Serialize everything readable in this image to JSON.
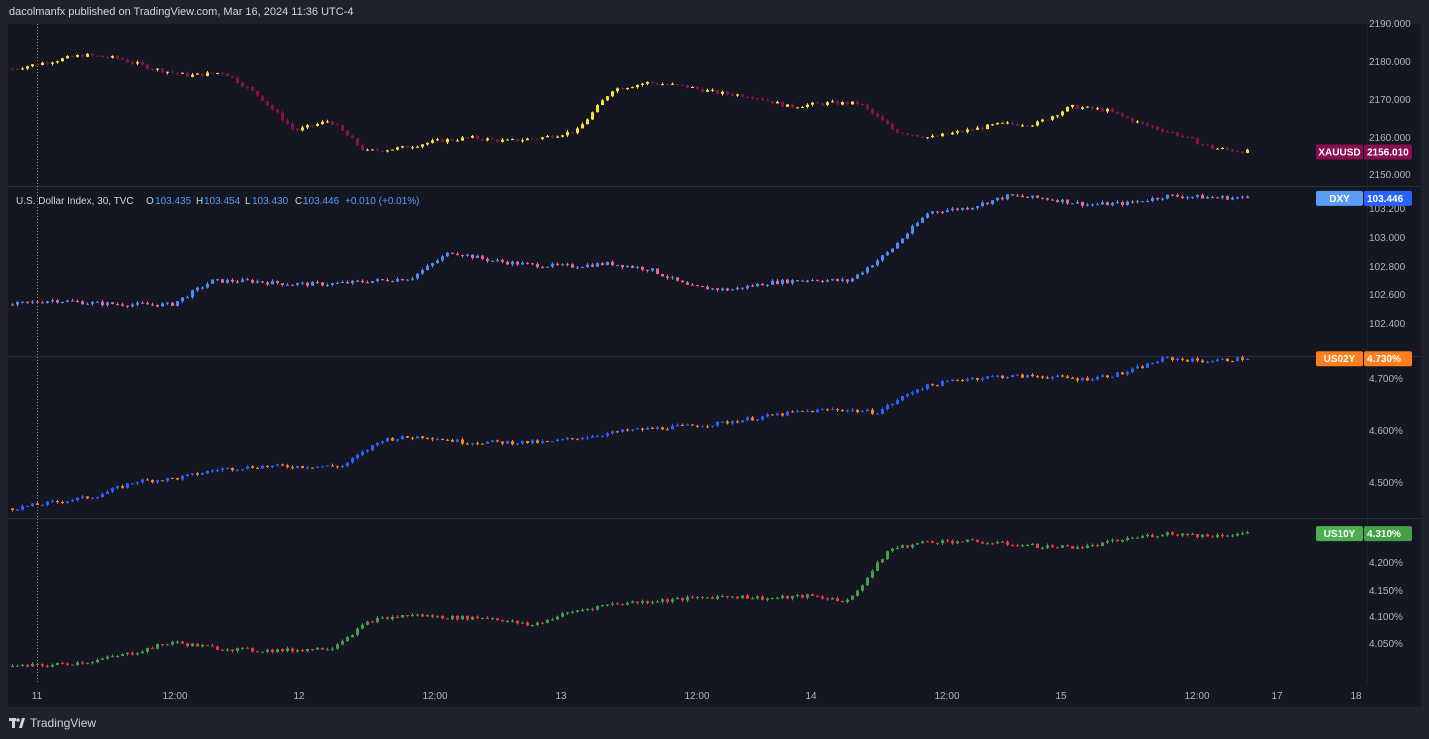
{
  "header": {
    "publisher_line": "dacolmanfx published on TradingView.com, Mar 16, 2024 11:36 UTC-4"
  },
  "footer": {
    "brand": "TradingView"
  },
  "legend": {
    "dxy": {
      "name": "U.S. Dollar Index, 30, TVC",
      "o_label": "O",
      "o_value": "103.435",
      "h_label": "H",
      "h_value": "103.454",
      "l_label": "L",
      "l_value": "103.430",
      "c_label": "C",
      "c_value": "103.446",
      "change": "+0.010 (+0.01%)"
    }
  },
  "colors": {
    "background": "#141722",
    "xauusd_up": "#f5e13a",
    "xauusd_down": "#880e4f",
    "dxy_up": "#4c8ef5",
    "dxy_down": "#f06292",
    "us02y_up": "#2962ff",
    "us02y_down": "#ff7f1e",
    "us10y_up": "#43a047",
    "us10y_down": "#f23645"
  },
  "x_axis": {
    "ticks": [
      "11",
      "12:00",
      "12",
      "12:00",
      "13",
      "12:00",
      "14",
      "12:00",
      "15",
      "12:00",
      "17",
      "18"
    ]
  },
  "chart_data": [
    {
      "type": "candlestick",
      "symbol": "XAUUSD",
      "last_value": "2156.010",
      "ylim": [
        2146,
        2193
      ],
      "y_ticks": [
        "2190.000",
        "2180.000",
        "2170.000",
        "2160.000",
        "2150.000"
      ],
      "x": [
        "11",
        "12:00",
        "12",
        "12:00",
        "13",
        "12:00",
        "14",
        "12:00",
        "15",
        "12:00"
      ],
      "close_path": [
        2180,
        2182,
        2184,
        2183,
        2180,
        2178,
        2179,
        2172,
        2162,
        2165,
        2156,
        2157,
        2159,
        2160,
        2159,
        2160,
        2162,
        2174,
        2176,
        2175,
        2173,
        2172,
        2169,
        2170,
        2170,
        2162,
        2160,
        2162,
        2164,
        2164,
        2169,
        2168,
        2164,
        2161,
        2157,
        2156
      ]
    },
    {
      "type": "candlestick",
      "symbol": "DXY",
      "last_value": "103.446",
      "ylim": [
        102.37,
        103.52
      ],
      "y_ticks": [
        "103.200",
        "103.000",
        "102.800",
        "102.600",
        "102.400"
      ],
      "x": [
        "11",
        "12:00",
        "12",
        "12:00",
        "13",
        "12:00",
        "14",
        "12:00",
        "15",
        "12:00"
      ],
      "close_path": [
        102.72,
        102.75,
        102.73,
        102.72,
        102.72,
        102.88,
        102.88,
        102.86,
        102.86,
        102.88,
        102.9,
        103.08,
        103.02,
        102.99,
        102.98,
        103.0,
        102.96,
        102.84,
        102.82,
        102.87,
        102.89,
        102.88,
        103.08,
        103.35,
        103.38,
        103.46,
        103.44,
        103.4,
        103.41,
        103.46,
        103.45,
        103.446
      ]
    },
    {
      "type": "candlestick",
      "symbol": "US02Y",
      "last_value": "4.730%",
      "ylim": [
        4.464,
        4.732
      ],
      "y_ticks": [
        "4.700%",
        "4.600%",
        "4.500%"
      ],
      "x": [
        "11",
        "12:00",
        "12",
        "12:00",
        "13",
        "12:00",
        "14",
        "12:00",
        "15",
        "12:00"
      ],
      "close_path": [
        4.48,
        4.49,
        4.5,
        4.525,
        4.53,
        4.545,
        4.55,
        4.55,
        4.55,
        4.595,
        4.6,
        4.59,
        4.59,
        4.59,
        4.6,
        4.61,
        4.615,
        4.62,
        4.63,
        4.64,
        4.645,
        4.64,
        4.68,
        4.695,
        4.7,
        4.7,
        4.695,
        4.705,
        4.73,
        4.725,
        4.73
      ]
    },
    {
      "type": "candlestick",
      "symbol": "US10Y",
      "last_value": "4.310%",
      "ylim": [
        4.035,
        4.336
      ],
      "y_ticks": [
        "4.250%",
        "4.200%",
        "4.150%",
        "4.100%",
        "4.050%"
      ],
      "x": [
        "11",
        "12:00",
        "12",
        "12:00",
        "13",
        "12:00",
        "14",
        "12:00",
        "15",
        "12:00"
      ],
      "close_path": [
        4.065,
        4.068,
        4.075,
        4.09,
        4.11,
        4.1,
        4.095,
        4.095,
        4.1,
        4.15,
        4.16,
        4.155,
        4.155,
        4.14,
        4.165,
        4.18,
        4.185,
        4.19,
        4.195,
        4.19,
        4.195,
        4.185,
        4.28,
        4.295,
        4.295,
        4.29,
        4.285,
        4.285,
        4.3,
        4.31,
        4.305,
        4.31
      ]
    }
  ]
}
